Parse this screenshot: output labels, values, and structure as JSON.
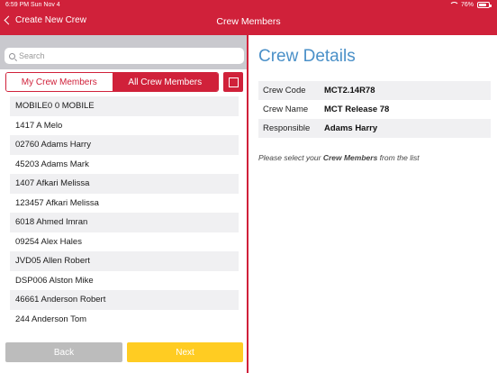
{
  "status_bar": {
    "time": "6:59 PM",
    "date": "Sun Nov 4",
    "battery": "76%",
    "battery_level": 0.76
  },
  "nav": {
    "back_label": "Create New Crew",
    "title": "Crew Members"
  },
  "search": {
    "placeholder": "Search",
    "value": ""
  },
  "segments": {
    "my_crew_label": "My Crew Members",
    "all_crew_label": "All Crew Members",
    "selected": "All Crew Members"
  },
  "members": [
    "MOBILE0 0  MOBILE",
    "1417 A  Melo",
    "02760 Adams  Harry",
    "45203 Adams  Mark",
    "1407 Afkari  Melissa",
    "123457 Afkari  Melissa",
    "6018 Ahmed  Imran",
    "09254 Alex  Hales",
    "JVD05 Allen  Robert",
    "DSP006 Alston  Mike",
    "46661 Anderson  Robert",
    "244 Anderson  Tom"
  ],
  "footer": {
    "back_label": "Back",
    "next_label": "Next"
  },
  "details": {
    "title": "Crew Details",
    "rows": [
      {
        "label": "Crew Code",
        "value": "MCT2.14R78"
      },
      {
        "label": "Crew Name",
        "value": "MCT Release 78"
      },
      {
        "label": "Responsible",
        "value": "Adams  Harry"
      }
    ],
    "hint_prefix": "Please select your ",
    "hint_bold": "Crew Members",
    "hint_suffix": " from the list"
  },
  "colors": {
    "brand_red": "#d0213a",
    "title_blue": "#4a90c8",
    "next_yellow": "#ffcc22",
    "back_gray": "#bcbcbc"
  }
}
